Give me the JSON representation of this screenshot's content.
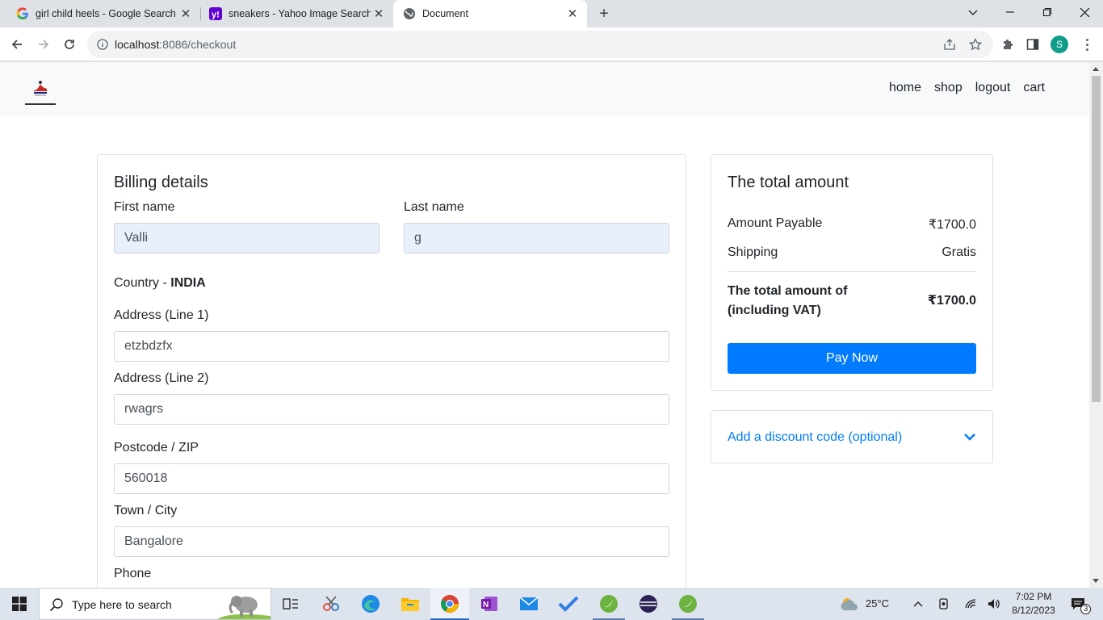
{
  "browser": {
    "tabs": [
      {
        "title": "girl child heels - Google Search",
        "icon": "google-icon"
      },
      {
        "title": "sneakers - Yahoo Image Search Results",
        "icon": "yahoo-icon"
      },
      {
        "title": "Document",
        "icon": "globe-icon"
      }
    ],
    "url_host": "localhost",
    "url_rest": ":8086/checkout",
    "profile_initial": "S"
  },
  "site": {
    "nav": {
      "home": "home",
      "shop": "shop",
      "logout": "logout",
      "cart": "cart"
    }
  },
  "billing": {
    "title": "Billing details",
    "first_name_label": "First name",
    "first_name_value": "Valli",
    "last_name_label": "Last name",
    "last_name_value": "g",
    "country_label": "Country - ",
    "country_value": "INDIA",
    "address1_label": "Address (Line 1)",
    "address1_value": "etzbdzfx",
    "address2_label": "Address (Line 2)",
    "address2_value": "rwagrs",
    "postcode_label": "Postcode / ZIP",
    "postcode_value": "560018",
    "town_label": "Town / City",
    "town_value": "Bangalore",
    "phone_label": "Phone"
  },
  "summary": {
    "title": "The total amount",
    "amount_payable_label": "Amount Payable",
    "amount_payable_value": "₹1700.0",
    "shipping_label": "Shipping",
    "shipping_value": "Gratis",
    "total_label_line1": "The total amount of",
    "total_label_line2": "(including VAT)",
    "total_value": "₹1700.0",
    "pay_button": "Pay Now"
  },
  "discount": {
    "link": "Add a discount code (optional)"
  },
  "taskbar": {
    "search_placeholder": "Type here to search",
    "weather": "25°C",
    "time": "7:02 PM",
    "date": "8/12/2023",
    "notification_count": "3"
  },
  "colors": {
    "primary": "#007bff",
    "autofill": "#e8f0fe",
    "nav_bg": "#f8f9fa"
  }
}
